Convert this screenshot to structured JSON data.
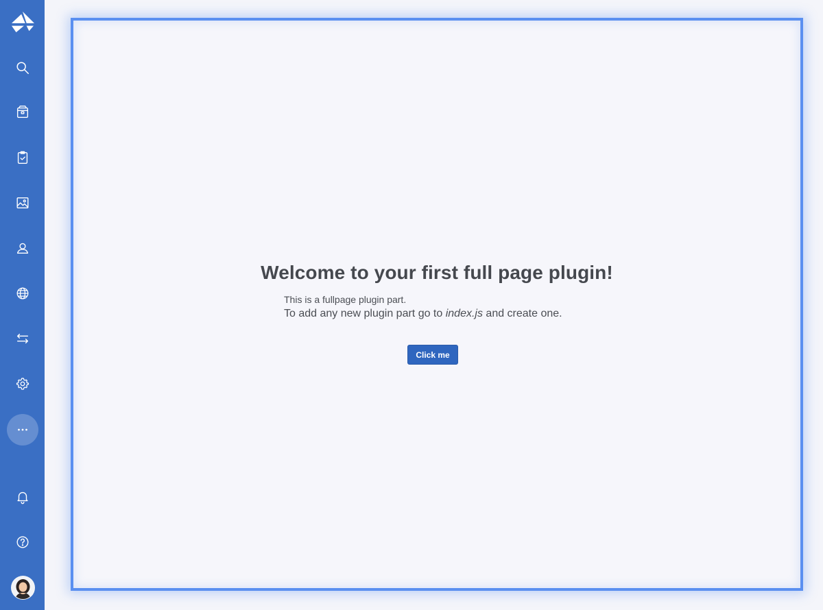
{
  "sidebar": {
    "logo": "sanity-logo-icon",
    "items": [
      {
        "icon": "search-icon"
      },
      {
        "icon": "package-icon"
      },
      {
        "icon": "clipboard-check-icon"
      },
      {
        "icon": "image-icon"
      },
      {
        "icon": "user-icon"
      },
      {
        "icon": "globe-icon"
      },
      {
        "icon": "transfer-arrows-icon"
      },
      {
        "icon": "gear-icon"
      },
      {
        "icon": "more-icon"
      },
      {
        "icon": "bell-icon"
      },
      {
        "icon": "help-icon"
      }
    ],
    "avatar": "avatar"
  },
  "main": {
    "title": "Welcome to your first full page plugin!",
    "line1": "This is a fullpage plugin part.",
    "line2_prefix": "To add any new plugin part go to ",
    "line2_file": "index.js",
    "line2_suffix": " and create one.",
    "button_label": "Click me"
  },
  "colors": {
    "sidebar": "#3a6fc4",
    "frame_border": "#5a8ff0",
    "button": "#2f66bf",
    "background": "#f4f5fa"
  }
}
